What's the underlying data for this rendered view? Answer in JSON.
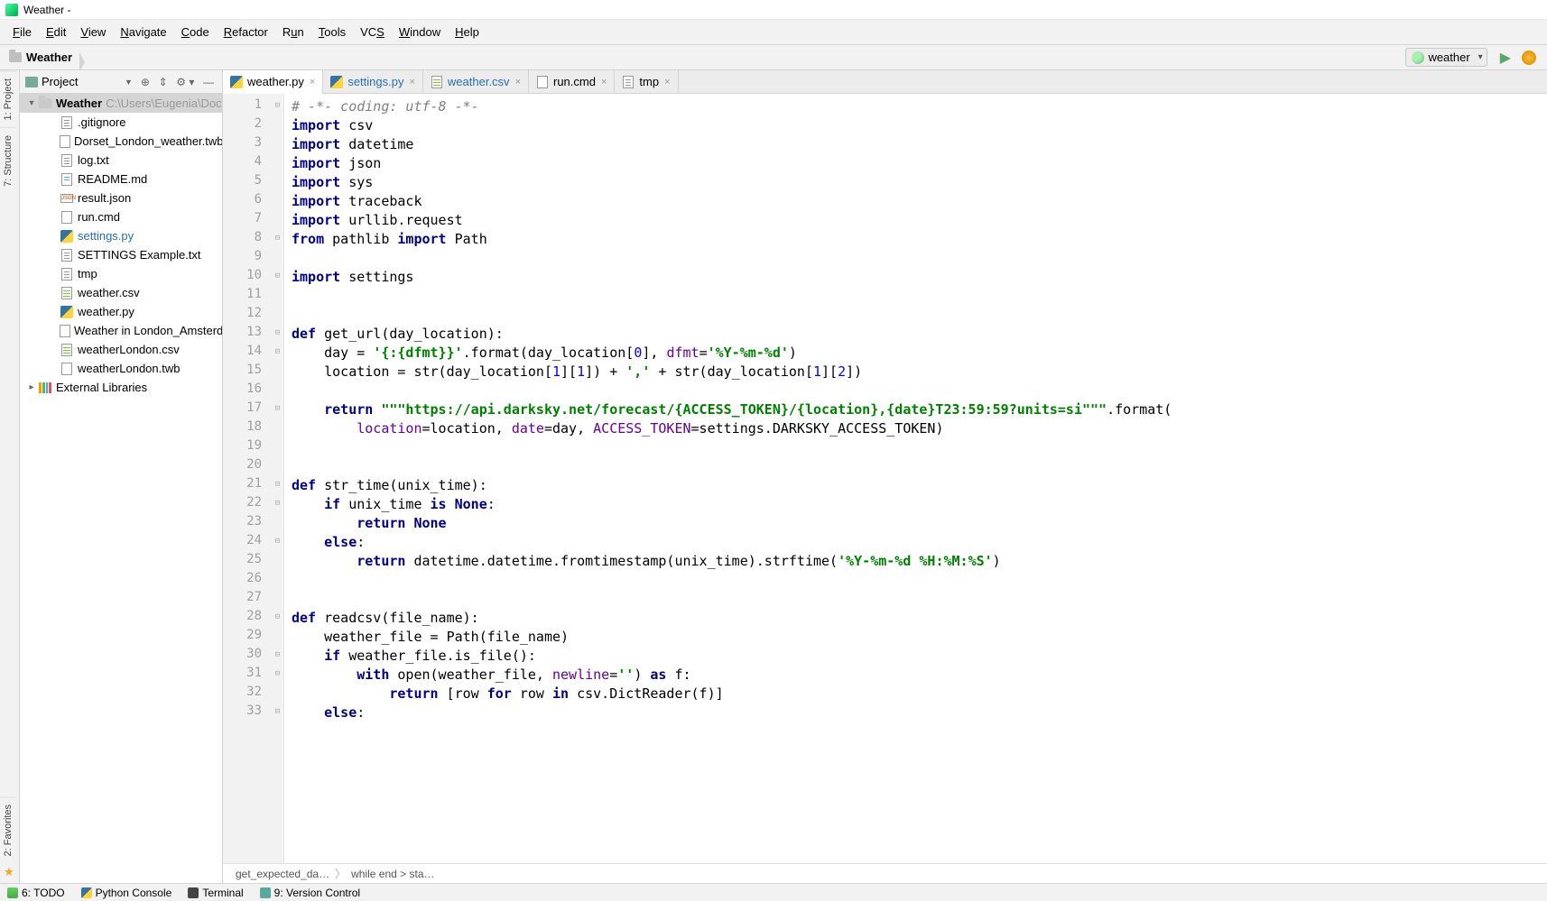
{
  "window": {
    "title": "Weather -"
  },
  "menu": [
    "File",
    "Edit",
    "View",
    "Navigate",
    "Code",
    "Refactor",
    "Run",
    "Tools",
    "VCS",
    "Window",
    "Help"
  ],
  "breadcrumb": {
    "root": "Weather"
  },
  "runConfig": {
    "selected": "weather"
  },
  "leftTabs": [
    "1: Project",
    "7: Structure",
    "2: Favorites"
  ],
  "toolWindow": {
    "title": "Project"
  },
  "tree": {
    "root": {
      "name": "Weather",
      "path": "C:\\Users\\Eugenia\\Doc"
    },
    "files": [
      {
        "name": ".gitignore",
        "type": "txt"
      },
      {
        "name": "Dorset_London_weather.twb",
        "type": "twb"
      },
      {
        "name": "log.txt",
        "type": "txt"
      },
      {
        "name": "README.md",
        "type": "md"
      },
      {
        "name": "result.json",
        "type": "json"
      },
      {
        "name": "run.cmd",
        "type": "cmd"
      },
      {
        "name": "settings.py",
        "type": "py",
        "link": true
      },
      {
        "name": "SETTINGS Example.txt",
        "type": "txt"
      },
      {
        "name": "tmp",
        "type": "txt"
      },
      {
        "name": "weather.csv",
        "type": "csv"
      },
      {
        "name": "weather.py",
        "type": "py"
      },
      {
        "name": "Weather in London_Amsterd",
        "type": "twb"
      },
      {
        "name": "weatherLondon.csv",
        "type": "csv"
      },
      {
        "name": "weatherLondon.twb",
        "type": "twb"
      }
    ],
    "ext": "External Libraries"
  },
  "tabs": [
    {
      "label": "weather.py",
      "type": "py",
      "active": true
    },
    {
      "label": "settings.py",
      "type": "py",
      "link": true
    },
    {
      "label": "weather.csv",
      "type": "csv",
      "link": true
    },
    {
      "label": "run.cmd",
      "type": "cmd"
    },
    {
      "label": "tmp",
      "type": "txt"
    }
  ],
  "lineCount": 33,
  "editorCrumb": [
    "get_expected_da…",
    "while end > sta…"
  ],
  "bottomBar": [
    "6: TODO",
    "Python Console",
    "Terminal",
    "9: Version Control"
  ]
}
